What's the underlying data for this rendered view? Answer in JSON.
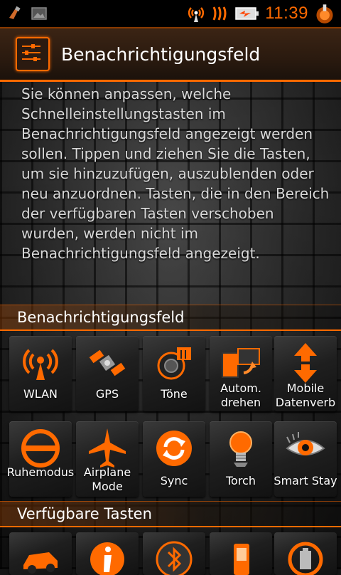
{
  "status_bar": {
    "clock": "11:39",
    "icons": [
      "usb-icon",
      "image-notification-icon",
      "wifi-hotspot-icon",
      "signal-icon",
      "battery-icon",
      "app-notification-icon"
    ]
  },
  "header": {
    "title": "Benachrichtigungsfeld",
    "icon": "sliders-settings-icon"
  },
  "description": "Sie können anpassen, welche Schnelleinstellungstasten im Benachrichtigungsfeld angezeigt werden sollen. Tippen und ziehen Sie die Tasten, um sie hinzuzufügen, auszublenden oder neu anzuordnen. Tasten, die in den Bereich der verfügbaren Tasten verschoben wurden, werden nicht im Benachrichtigungsfeld angezeigt.",
  "panel_section": {
    "title": "Benachrichtigungsfeld",
    "tiles": [
      {
        "label": "WLAN",
        "icon": "wifi-broadcast-icon"
      },
      {
        "label": "GPS",
        "icon": "satellite-icon"
      },
      {
        "label": "Töne",
        "icon": "speaker-icon"
      },
      {
        "label": "Autom. drehen",
        "icon": "rotate-icon"
      },
      {
        "label": "Mobile Datenverb",
        "icon": "data-arrows-icon"
      },
      {
        "label": "Ruhemodus",
        "icon": "do-not-disturb-icon"
      },
      {
        "label": "Airplane Mode",
        "icon": "airplane-icon"
      },
      {
        "label": "Sync",
        "icon": "sync-icon"
      },
      {
        "label": "Torch",
        "icon": "light-bulb-icon"
      },
      {
        "label": "Smart Stay",
        "icon": "eye-icon"
      }
    ]
  },
  "available_section": {
    "title": "Verfügbare Tasten",
    "tiles": [
      {
        "icon": "car-icon"
      },
      {
        "icon": "info-icon"
      },
      {
        "icon": "bluetooth-icon"
      },
      {
        "icon": "phone-icon"
      },
      {
        "icon": "power-saving-icon"
      }
    ]
  },
  "colors": {
    "accent": "#ff6a00",
    "header_bg": "#2a1a0f",
    "text": "#ffffff",
    "description_text": "#d9d9d9"
  }
}
